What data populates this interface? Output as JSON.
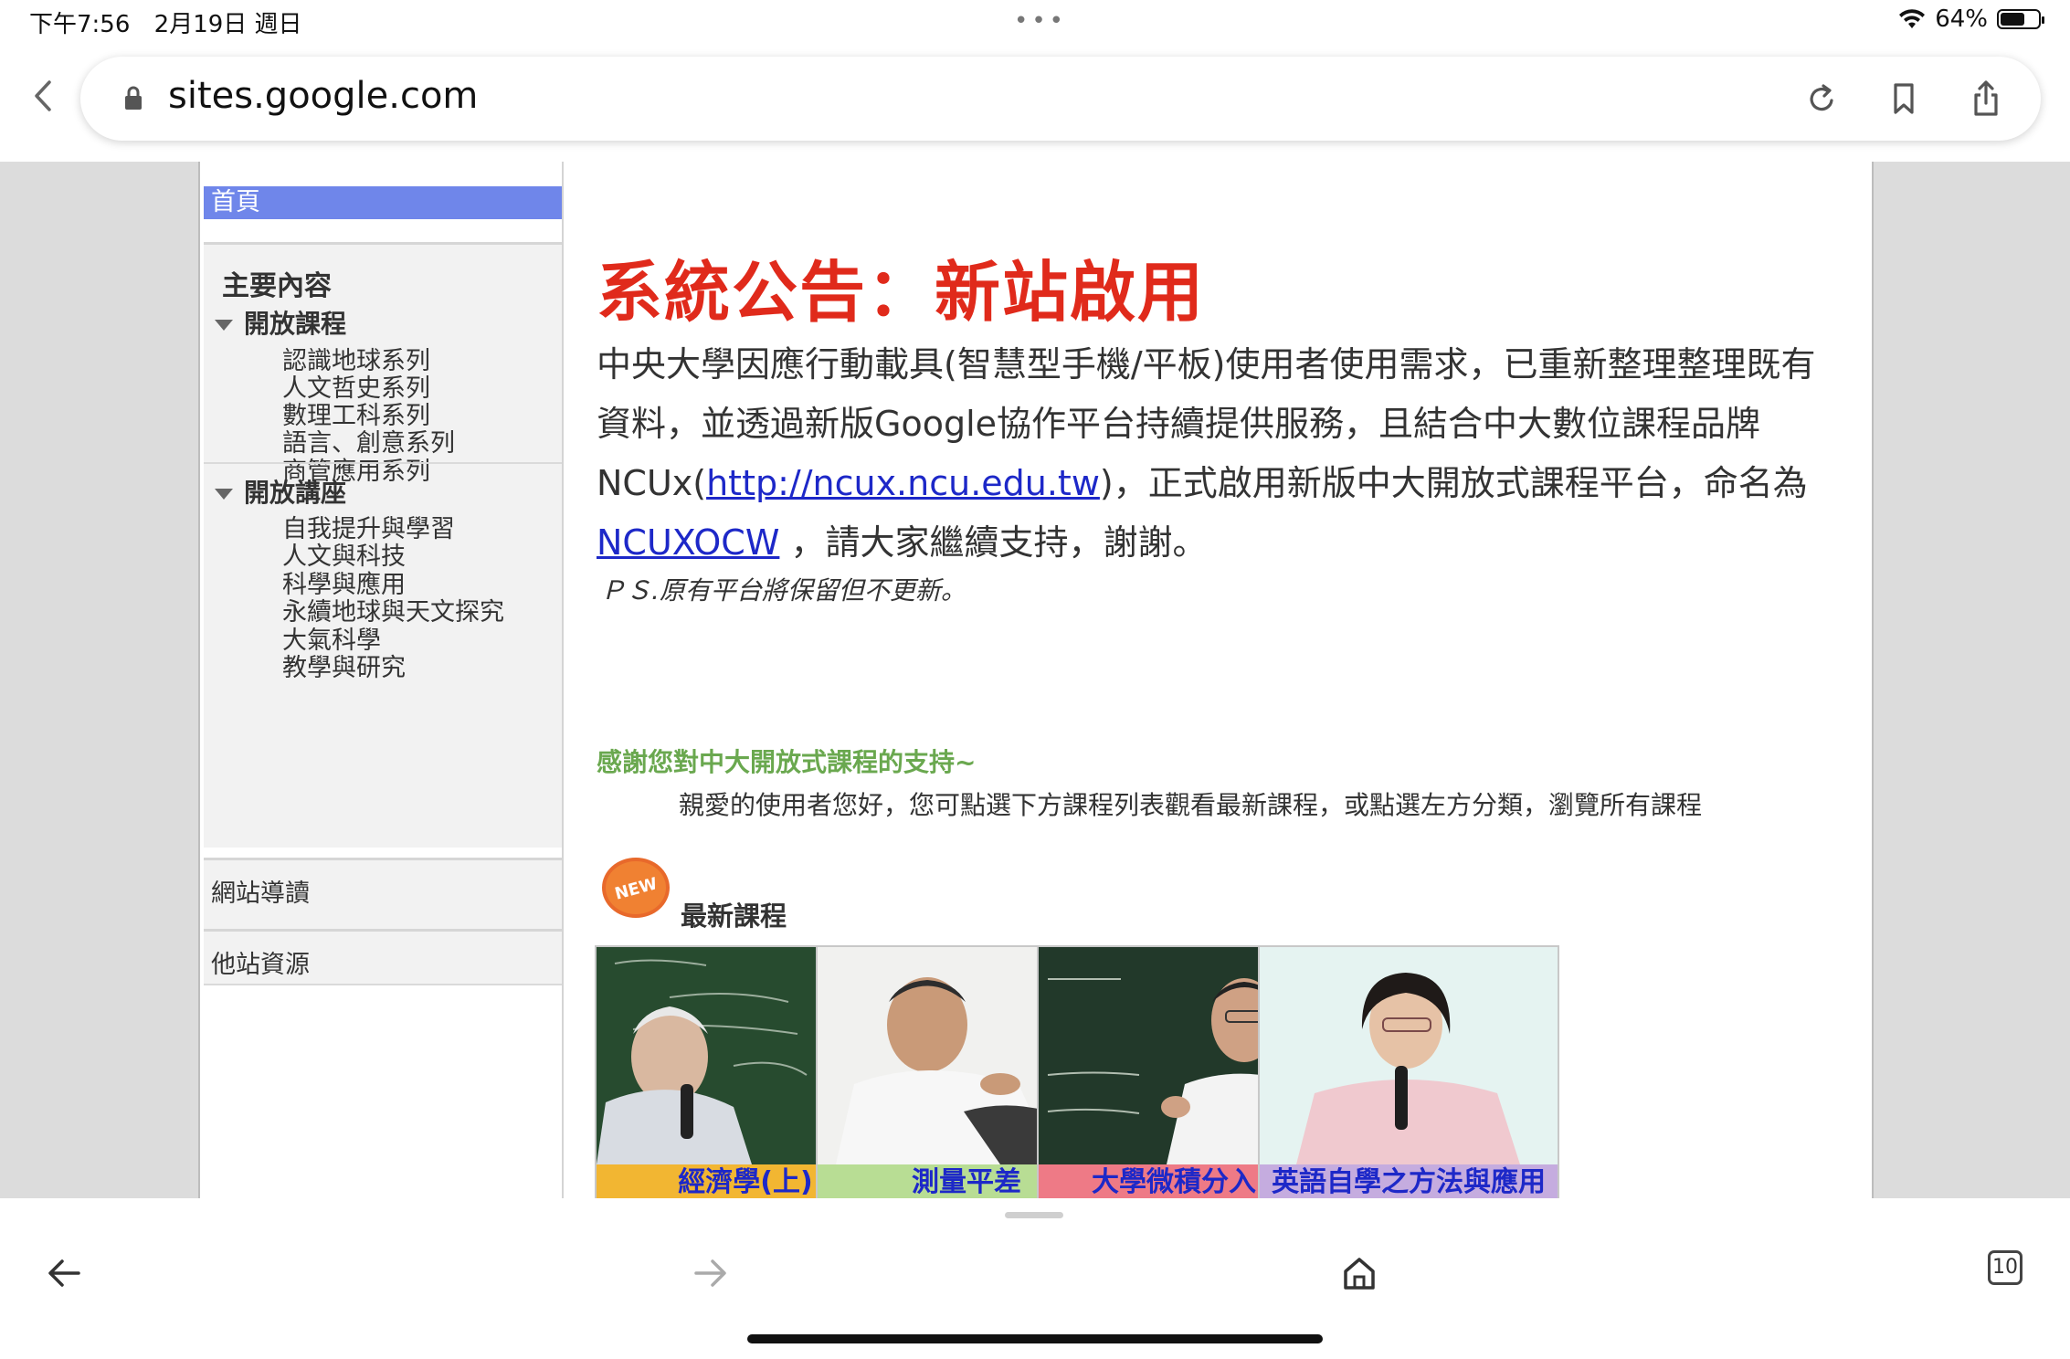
{
  "status_bar": {
    "time": "下午7:56",
    "date": "2月19日 週日",
    "battery_pct": "64%",
    "battery_level": 0.64
  },
  "browser": {
    "url": "sites.google.com",
    "tab_count": "10"
  },
  "sidebar": {
    "home": "首頁",
    "heading": "主要內容",
    "categories": [
      {
        "label": "開放課程",
        "items": [
          "認識地球系列",
          "人文哲史系列",
          "數理工科系列",
          "語言、創意系列",
          "商管應用系列"
        ]
      },
      {
        "label": "開放講座",
        "items": [
          "自我提升與學習",
          "人文與科技",
          "科學與應用",
          "永續地球與天文探究",
          "大氣科學",
          "教學與研究"
        ]
      }
    ],
    "extra_links": [
      "網站導讀",
      "他站資源"
    ]
  },
  "announcement": {
    "title": "系統公告：新站啟用",
    "body_part1": "中央大學因應行動載具(智慧型手機/平板)使用者使用需求，已重新整理整理既有資料，並透過新版Google協作平台持續提供服務，且結合中大數位課程品牌NCUx(",
    "link_url": "http://ncux.ncu.edu.tw",
    "body_part2": ")，正式啟用新版中大開放式課程平台，命名為 ",
    "link_name": "NCUXOCW",
    "body_part3": " ，請大家繼續支持，謝謝。",
    "ps": "ＰＳ.原有平台將保留但不更新。"
  },
  "welcome": {
    "thanks": "感謝您對中大開放式課程的支持~",
    "greeting": "親愛的使用者您好，您可點選下方課程列表觀看最新課程，或點選左方分類，瀏覽所有課程"
  },
  "latest": {
    "badge": "NEW",
    "label": "最新課程",
    "courses": [
      {
        "title": "經濟學(上)",
        "bar_color": "#f2b632"
      },
      {
        "title": "測量平差",
        "bar_color": "#b8dd94"
      },
      {
        "title": "大學微積分入門",
        "bar_color": "#ee7a86"
      },
      {
        "title": "英語自學之方法與應用",
        "bar_color": "#c5acdf"
      }
    ]
  }
}
